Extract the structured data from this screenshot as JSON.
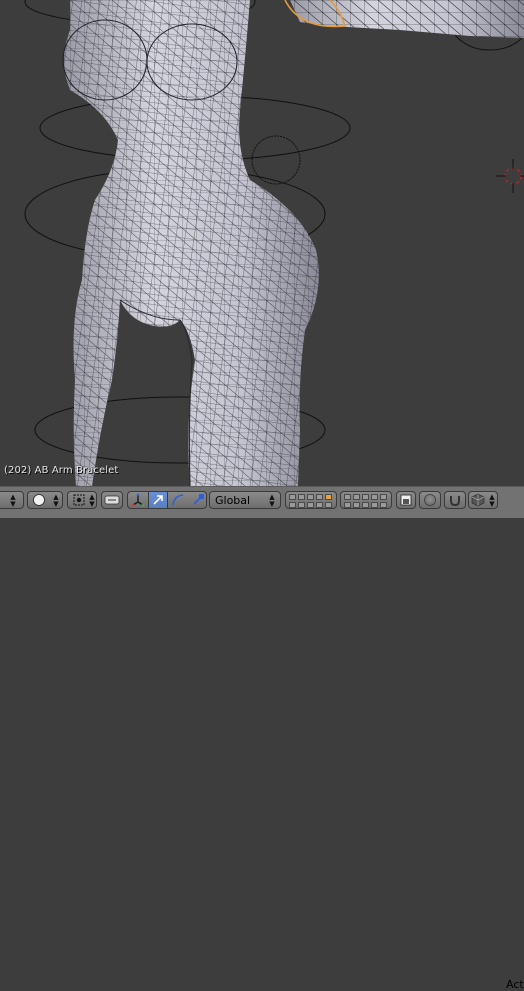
{
  "viewport": {
    "frame_label": "(202) AB Arm Bracelet"
  },
  "header": {
    "transform_orientation": "Global",
    "truncated_label": "Act"
  },
  "icons": {
    "viewport_shading": "circle-icon",
    "pivot_point": "pivot-icon",
    "manipulator_translate": "arrow-icon",
    "manipulator_rotate": "arc-icon",
    "manipulator_scale": "scale-icon",
    "layers": "layers-grid-icon",
    "proportional": "proportional-icon",
    "snap": "magnet-icon",
    "render": "camera-icon"
  },
  "colors": {
    "viewport_bg": "#3d3d3d",
    "header_bg": "#727272",
    "active_button": "#5680c2"
  }
}
